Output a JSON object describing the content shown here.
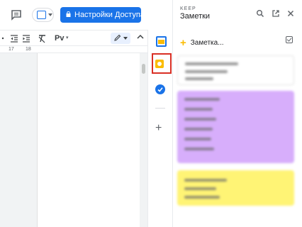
{
  "toolbar": {
    "comment_icon": "comment-icon",
    "share_icon": "share-upload-icon",
    "access_button_label": "Настройки Доступа",
    "brand_color": "#1a73e8"
  },
  "format_bar": {
    "pv_label": "Pv"
  },
  "ruler": {
    "ticks": [
      "17",
      "18"
    ]
  },
  "side_strip": {
    "icons": [
      "calendar-icon",
      "keep-icon",
      "tasks-icon",
      "add-icon"
    ],
    "selected": "keep-icon",
    "highlight_color": "#d93025"
  },
  "keep": {
    "label": "KEEP",
    "title": "Заметки",
    "new_note_placeholder": "Заметка...",
    "header_icons": [
      "search-icon",
      "open-new-icon",
      "close-icon"
    ],
    "note_colors": [
      "#ffffff",
      "#d7aefb",
      "#fff475"
    ]
  }
}
